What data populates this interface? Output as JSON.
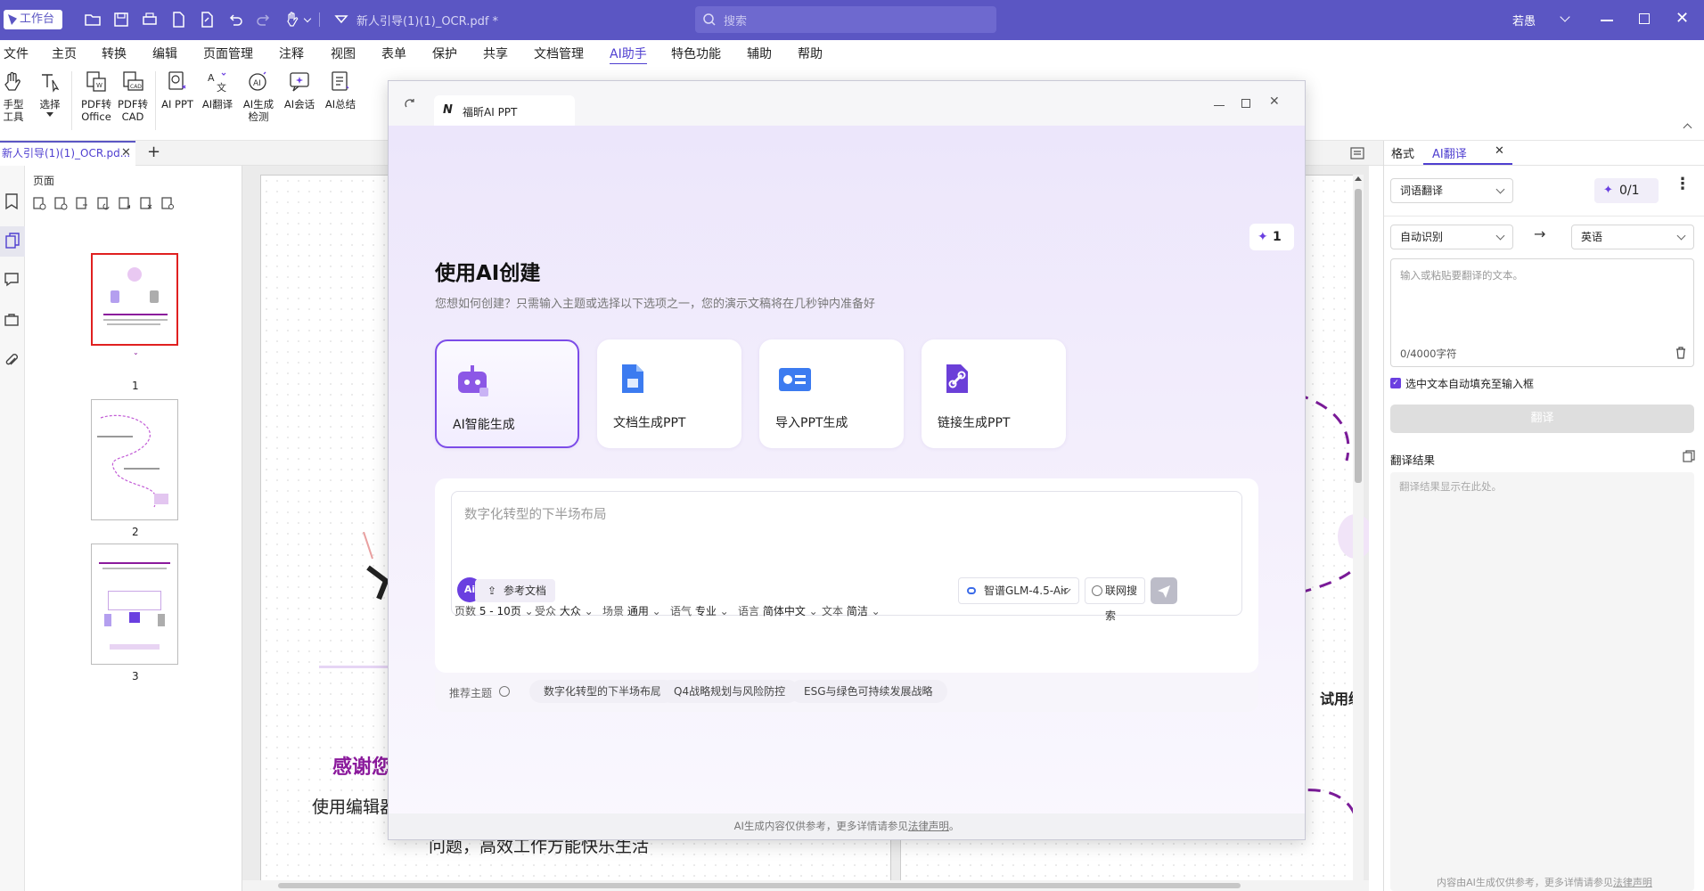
{
  "titlebar": {
    "workbench_label": "工作台",
    "doc_title": "新人引导(1)(1)_OCR.pdf *",
    "search_placeholder": "搜索",
    "user_name": "若愚"
  },
  "menu": [
    "文件",
    "主页",
    "转换",
    "编辑",
    "页面管理",
    "注释",
    "视图",
    "表单",
    "保护",
    "共享",
    "文档管理",
    "AI助手",
    "特色功能",
    "辅助",
    "帮助"
  ],
  "menu_active": "AI助手",
  "ribbon": {
    "hand_tool": [
      "手型",
      "工具"
    ],
    "select": "选择",
    "pdf_office": [
      "PDF转",
      "Office"
    ],
    "pdf_cad": [
      "PDF转",
      "CAD"
    ],
    "ai_ppt": "AI PPT",
    "ai_translate": "AI翻译",
    "ai_detect": [
      "AI生成",
      "检测"
    ],
    "ai_chat": "AI会话",
    "ai_summary": "AI总结"
  },
  "doc_tab": "新人引导(1)(1)_OCR.pd...",
  "page_panel": {
    "title": "页面",
    "page_numbers": [
      "1",
      "2",
      "3"
    ]
  },
  "document": {
    "thanks": "感谢您",
    "use_editor": "使用编辑器",
    "tail_text": "试用编",
    "bottom_text": "问题，高效工作方能快乐生活"
  },
  "modal": {
    "tab_title": "福昕AI PPT",
    "credits": "1",
    "heading": "使用AI创建",
    "subheading": "您想如何创建？只需输入主题或选择以下选项之一，您的演示文稿将在几秒钟内准备好",
    "cards": [
      "AI智能生成",
      "文档生成PPT",
      "导入PPT生成",
      "链接生成PPT"
    ],
    "input_placeholder": "数字化转型的下半场布局",
    "ref_doc": "参考文档",
    "ai_badge": "Ai",
    "model": "智谱GLM-4.5-Air",
    "web_search": "联网搜索",
    "options": [
      {
        "key": "页数",
        "value": "5 - 10页"
      },
      {
        "key": "受众",
        "value": "大众"
      },
      {
        "key": "场景",
        "value": "通用"
      },
      {
        "key": "语气",
        "value": "专业"
      },
      {
        "key": "语言",
        "value": "简体中文"
      },
      {
        "key": "文本",
        "value": "简洁"
      }
    ],
    "recommend_label": "推荐主题",
    "recommend_chips": [
      "数字化转型的下半场布局",
      "Q4战略规划与风险防控",
      "ESG与绿色可持续发展战略"
    ],
    "footer_prefix": "AI生成内容仅供参考，更多详情请参见",
    "footer_link": "法律声明",
    "footer_suffix": "。"
  },
  "right_panel": {
    "tabs": [
      "格式",
      "AI翻译"
    ],
    "mode": "词语翻译",
    "quota": "0/1",
    "source_lang": "自动识别",
    "target_lang": "英语",
    "input_placeholder": "输入或粘贴要翻译的文本。",
    "char_count": "0/4000字符",
    "autofill_label": "选中文本自动填充至输入框",
    "translate_button": "翻译",
    "result_label": "翻译结果",
    "result_placeholder": "翻译结果显示在此处。",
    "footer_prefix": "内容由AI生成仅供参考，更多详情请参见",
    "footer_link": "法律声明"
  },
  "colors": {
    "titlebar": "#5b56c3",
    "accent": "#6a3fe0",
    "purple_text": "#8b1a9c"
  }
}
